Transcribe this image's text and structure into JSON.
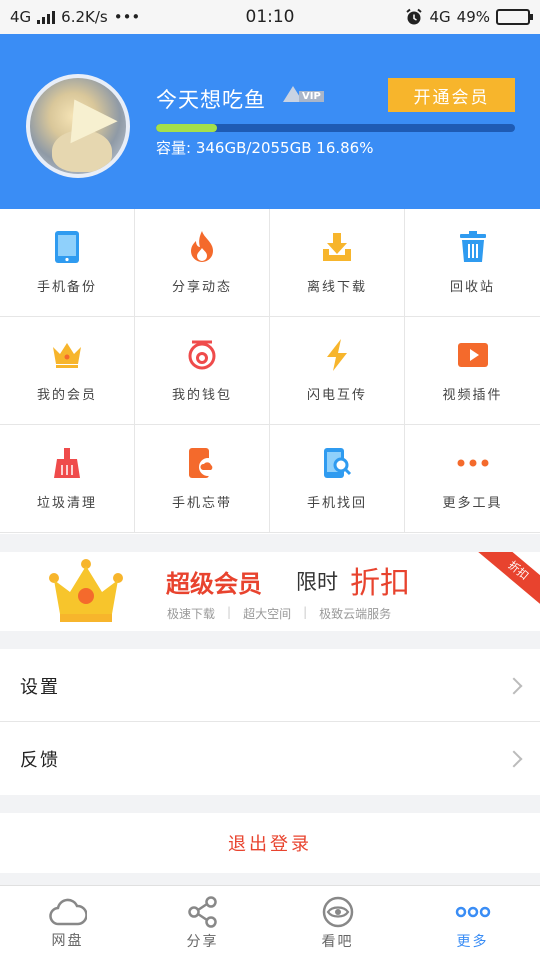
{
  "status_bar": {
    "network": "4G",
    "speed": "6.2K/s",
    "dots": "•••",
    "time": "01:10",
    "network_right": "4G",
    "battery": "49%",
    "battery_level": 0.49
  },
  "profile": {
    "username": "今天想吃鱼",
    "vip_badge": "VIP",
    "vip_button": "开通会员",
    "storage_text": "容量: 346GB/2055GB 16.86%",
    "storage_fraction": 0.1686
  },
  "grid": [
    {
      "label": "手机备份",
      "icon": "phone-backup-icon",
      "color": "#2f9bf0"
    },
    {
      "label": "分享动态",
      "icon": "fire-icon",
      "color": "#f46a2c"
    },
    {
      "label": "离线下载",
      "icon": "download-icon",
      "color": "#f7b52c"
    },
    {
      "label": "回收站",
      "icon": "trash-icon",
      "color": "#2f9bf0"
    },
    {
      "label": "我的会员",
      "icon": "crown-icon",
      "color": "#f7b52c"
    },
    {
      "label": "我的钱包",
      "icon": "wallet-icon",
      "color": "#ef4b4b"
    },
    {
      "label": "闪电互传",
      "icon": "lightning-icon",
      "color": "#f7b52c"
    },
    {
      "label": "视频插件",
      "icon": "video-icon",
      "color": "#f46a2c"
    },
    {
      "label": "垃圾清理",
      "icon": "broom-icon",
      "color": "#ef4b4b"
    },
    {
      "label": "手机忘带",
      "icon": "phone-cloud-icon",
      "color": "#f46a2c"
    },
    {
      "label": "手机找回",
      "icon": "phone-search-icon",
      "color": "#2f9bf0"
    },
    {
      "label": "更多工具",
      "icon": "more-dots-icon",
      "color": "#f46a2c"
    }
  ],
  "banner": {
    "title": "超级会员",
    "subtitle": "限时",
    "highlight": "折扣",
    "features": [
      "极速下载",
      "超大空间",
      "极致云端服务"
    ],
    "separator": "|",
    "corner_tag": "折扣"
  },
  "menu": {
    "settings": "设置",
    "feedback": "反馈"
  },
  "logout": "退出登录",
  "tabs": [
    {
      "label": "网盘",
      "icon": "cloud-icon",
      "active": false
    },
    {
      "label": "分享",
      "icon": "share-icon",
      "active": false
    },
    {
      "label": "看吧",
      "icon": "eye-icon",
      "active": false
    },
    {
      "label": "更多",
      "icon": "more-dots-icon",
      "active": true
    }
  ],
  "colors": {
    "primary": "#3a8df5",
    "accent": "#f7b52c",
    "red": "#e8432e",
    "progress": "#a5e04a"
  }
}
